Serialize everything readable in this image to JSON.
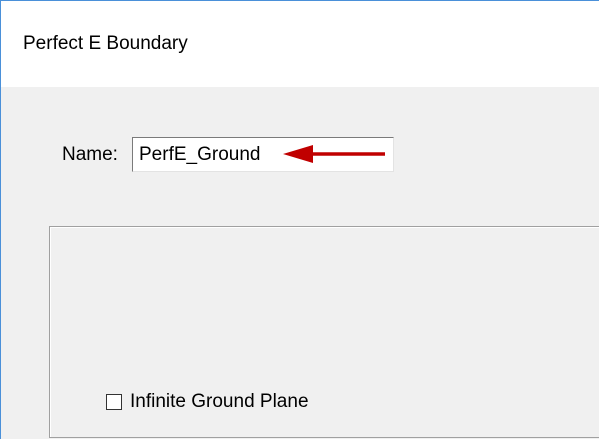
{
  "window": {
    "title": "Perfect E Boundary"
  },
  "form": {
    "name_label": "Name:",
    "name_value": "PerfE_Ground"
  },
  "options": {
    "infinite_ground_plane_label": "Infinite Ground Plane",
    "infinite_ground_plane_checked": false
  },
  "annotation": {
    "arrow_color": "#c00000"
  }
}
